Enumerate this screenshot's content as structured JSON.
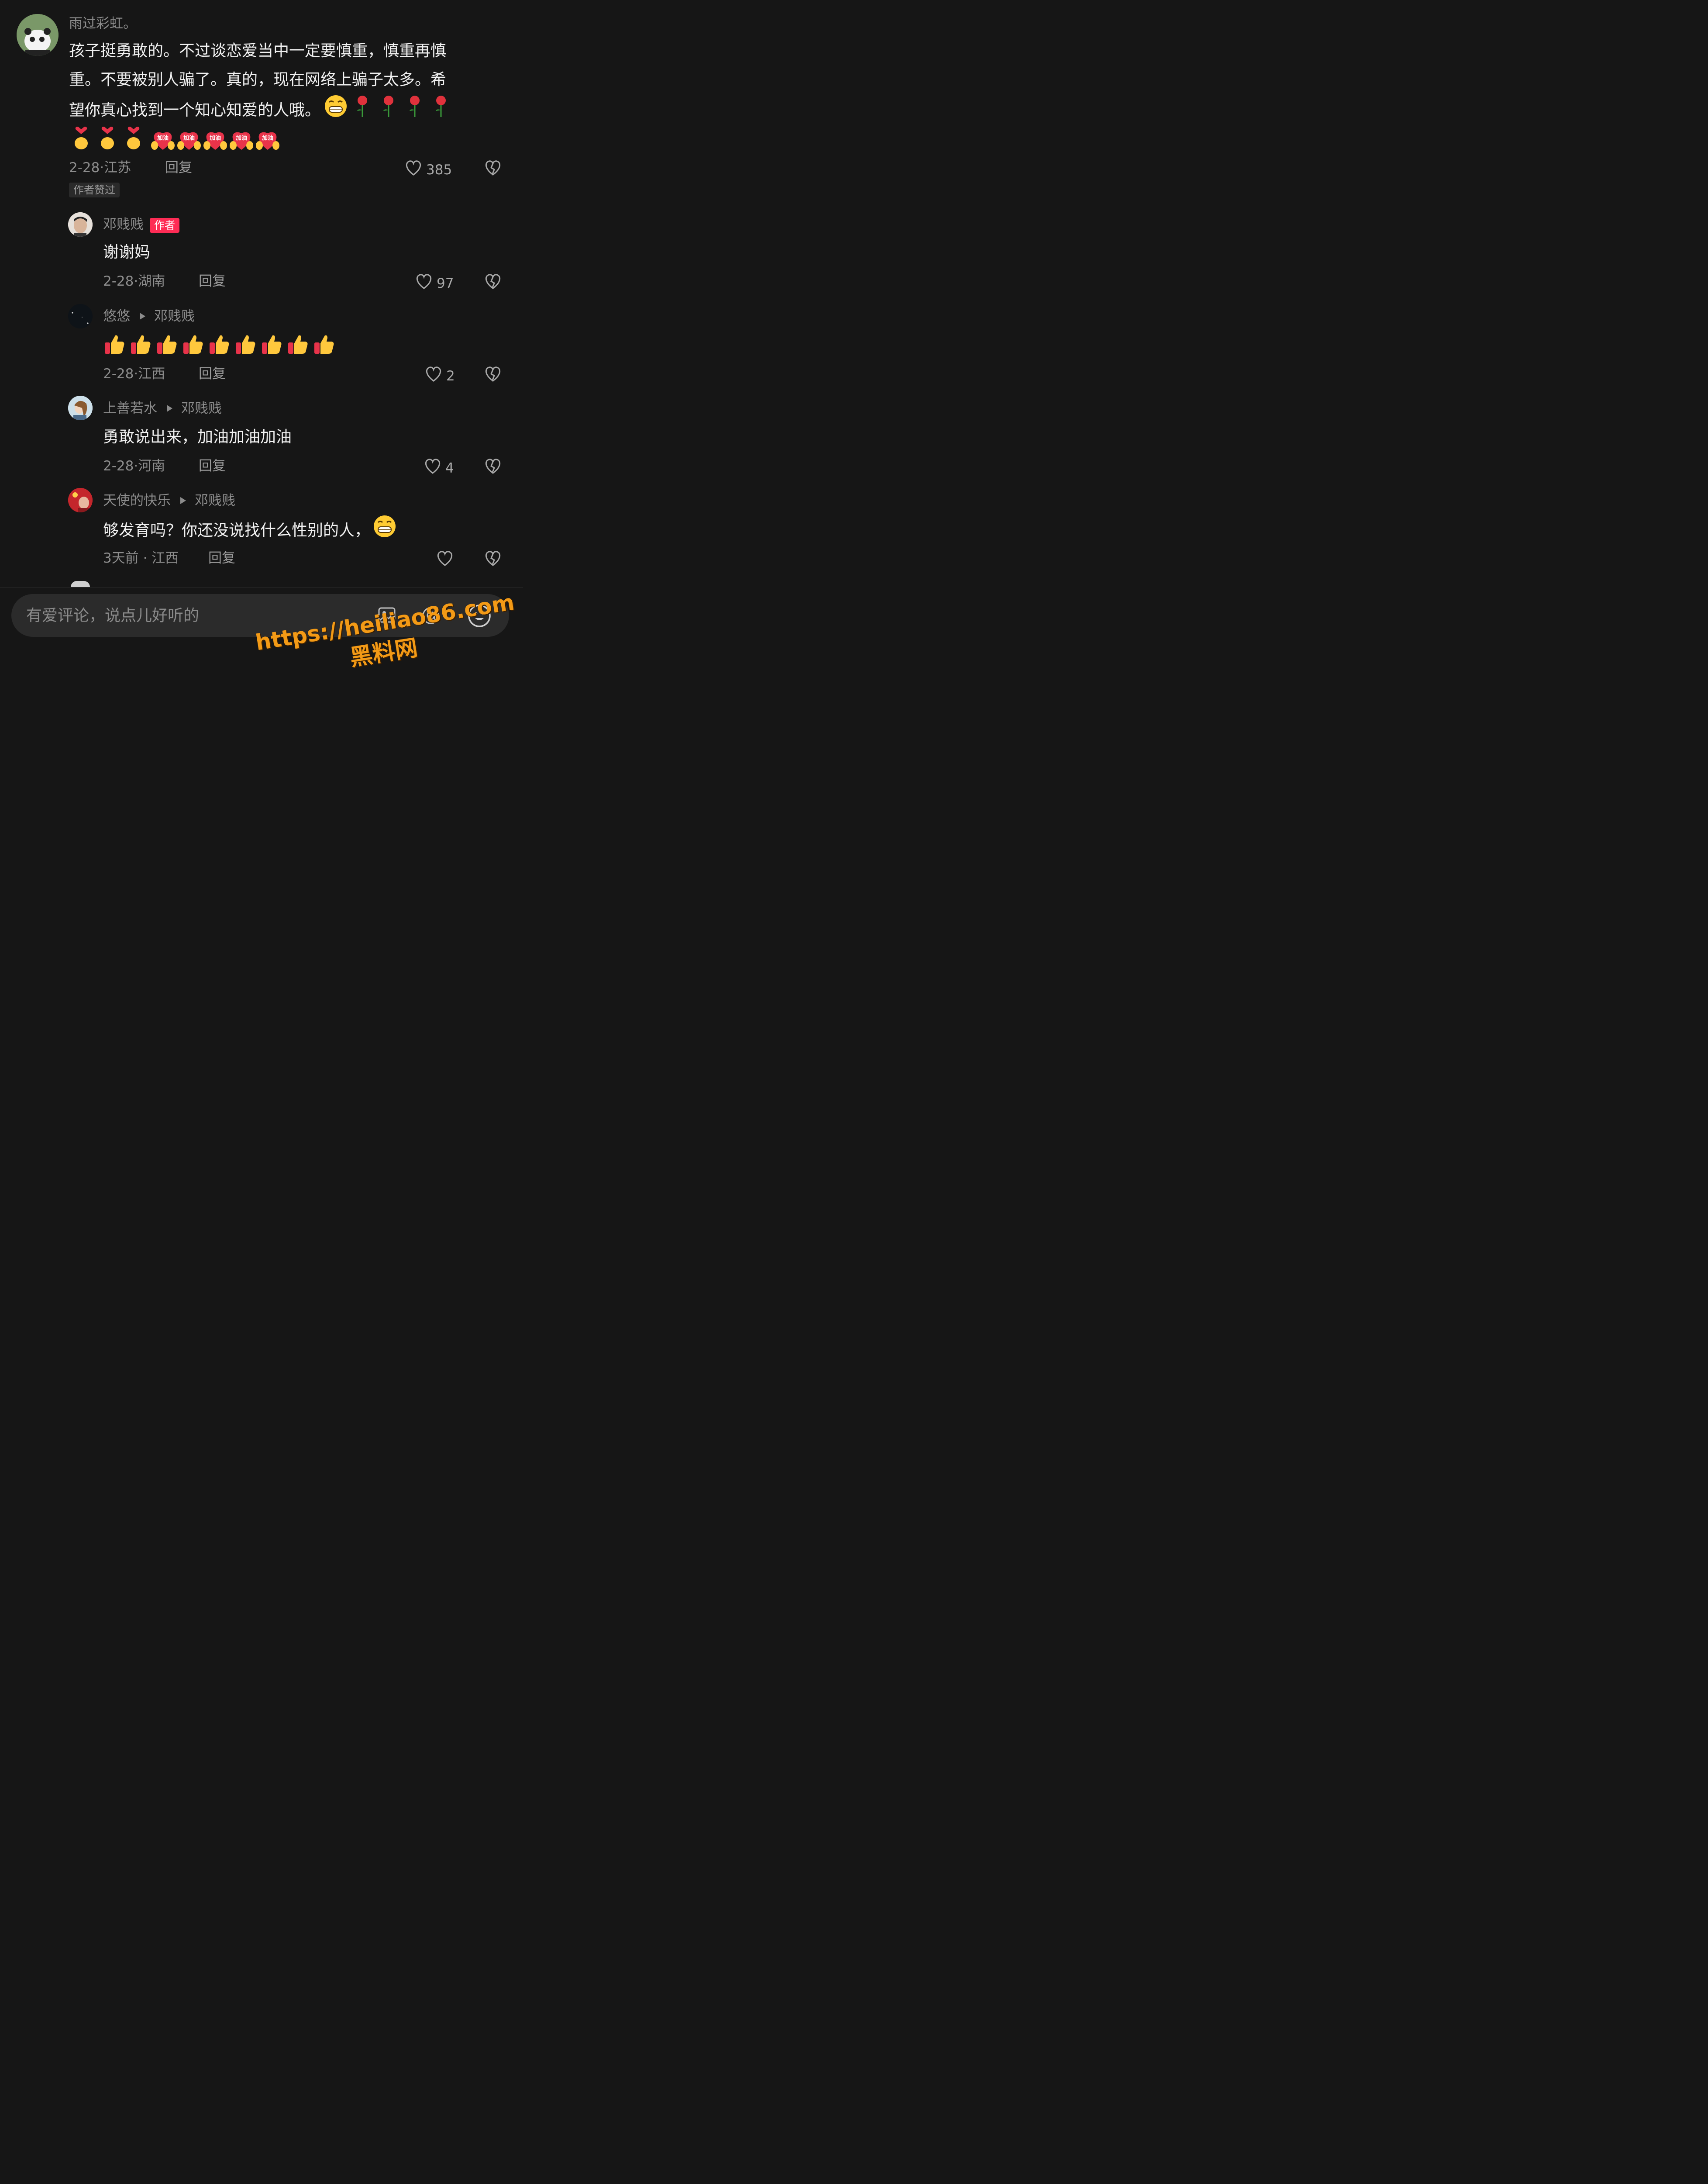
{
  "comments": [
    {
      "username": "雨过彩虹。",
      "text_lines": [
        "孩子挺勇敢的。不过谈恋爱当中一定要慎重，慎重再慎",
        "重。不要被别人骗了。真的，现在网络上骗子太多。希",
        "望你真心找到一个知心知爱的人哦。"
      ],
      "date": "2-28",
      "location": "江苏",
      "reply_label": "回复",
      "likes": "385",
      "badge": "作者赞过",
      "sticker_text": "加油"
    },
    {
      "username": "邓贱贱",
      "author_tag": "作者",
      "text": "谢谢妈",
      "date": "2-28",
      "location": "湖南",
      "reply_label": "回复",
      "likes": "97"
    },
    {
      "username": "悠悠",
      "reply_to": "邓贱贱",
      "date": "2-28",
      "location": "江西",
      "reply_label": "回复",
      "likes": "2"
    },
    {
      "username": "上善若水",
      "reply_to": "邓贱贱",
      "text": "勇敢说出来，加油加油加油",
      "date": "2-28",
      "location": "河南",
      "reply_label": "回复",
      "likes": "4"
    },
    {
      "username": "天使的快乐",
      "reply_to": "邓贱贱",
      "text": "够发育吗？你还没说找什么性别的人，",
      "date": "3天前",
      "location": "江西",
      "reply_label": "回复"
    }
  ],
  "input": {
    "placeholder": "有爱评论，说点儿好听的"
  },
  "watermark": {
    "url": "https://heiliao86.com",
    "name": "黑料网"
  }
}
